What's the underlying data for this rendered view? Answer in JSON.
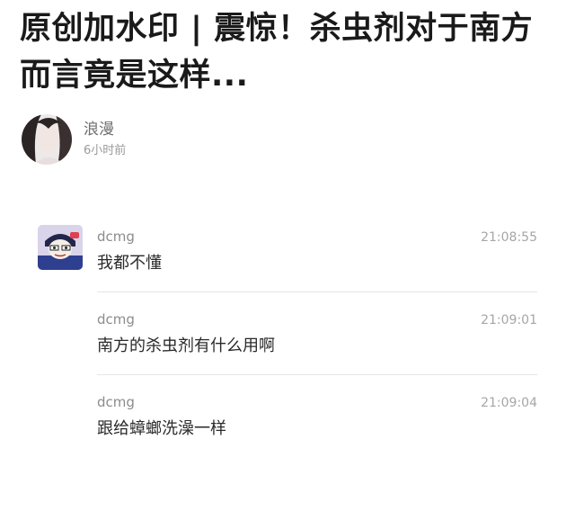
{
  "post": {
    "title": "原创加水印 | 震惊！杀虫剂对于南方而言竟是这样...",
    "author_name": "浪漫",
    "time": "6小时前"
  },
  "comments": [
    {
      "user": "dcmg",
      "time": "21:08:55",
      "text": "我都不懂"
    },
    {
      "user": "dcmg",
      "time": "21:09:01",
      "text": "南方的杀虫剂有什么用啊"
    },
    {
      "user": "dcmg",
      "time": "21:09:04",
      "text": "跟给蟑螂洗澡一样"
    }
  ]
}
